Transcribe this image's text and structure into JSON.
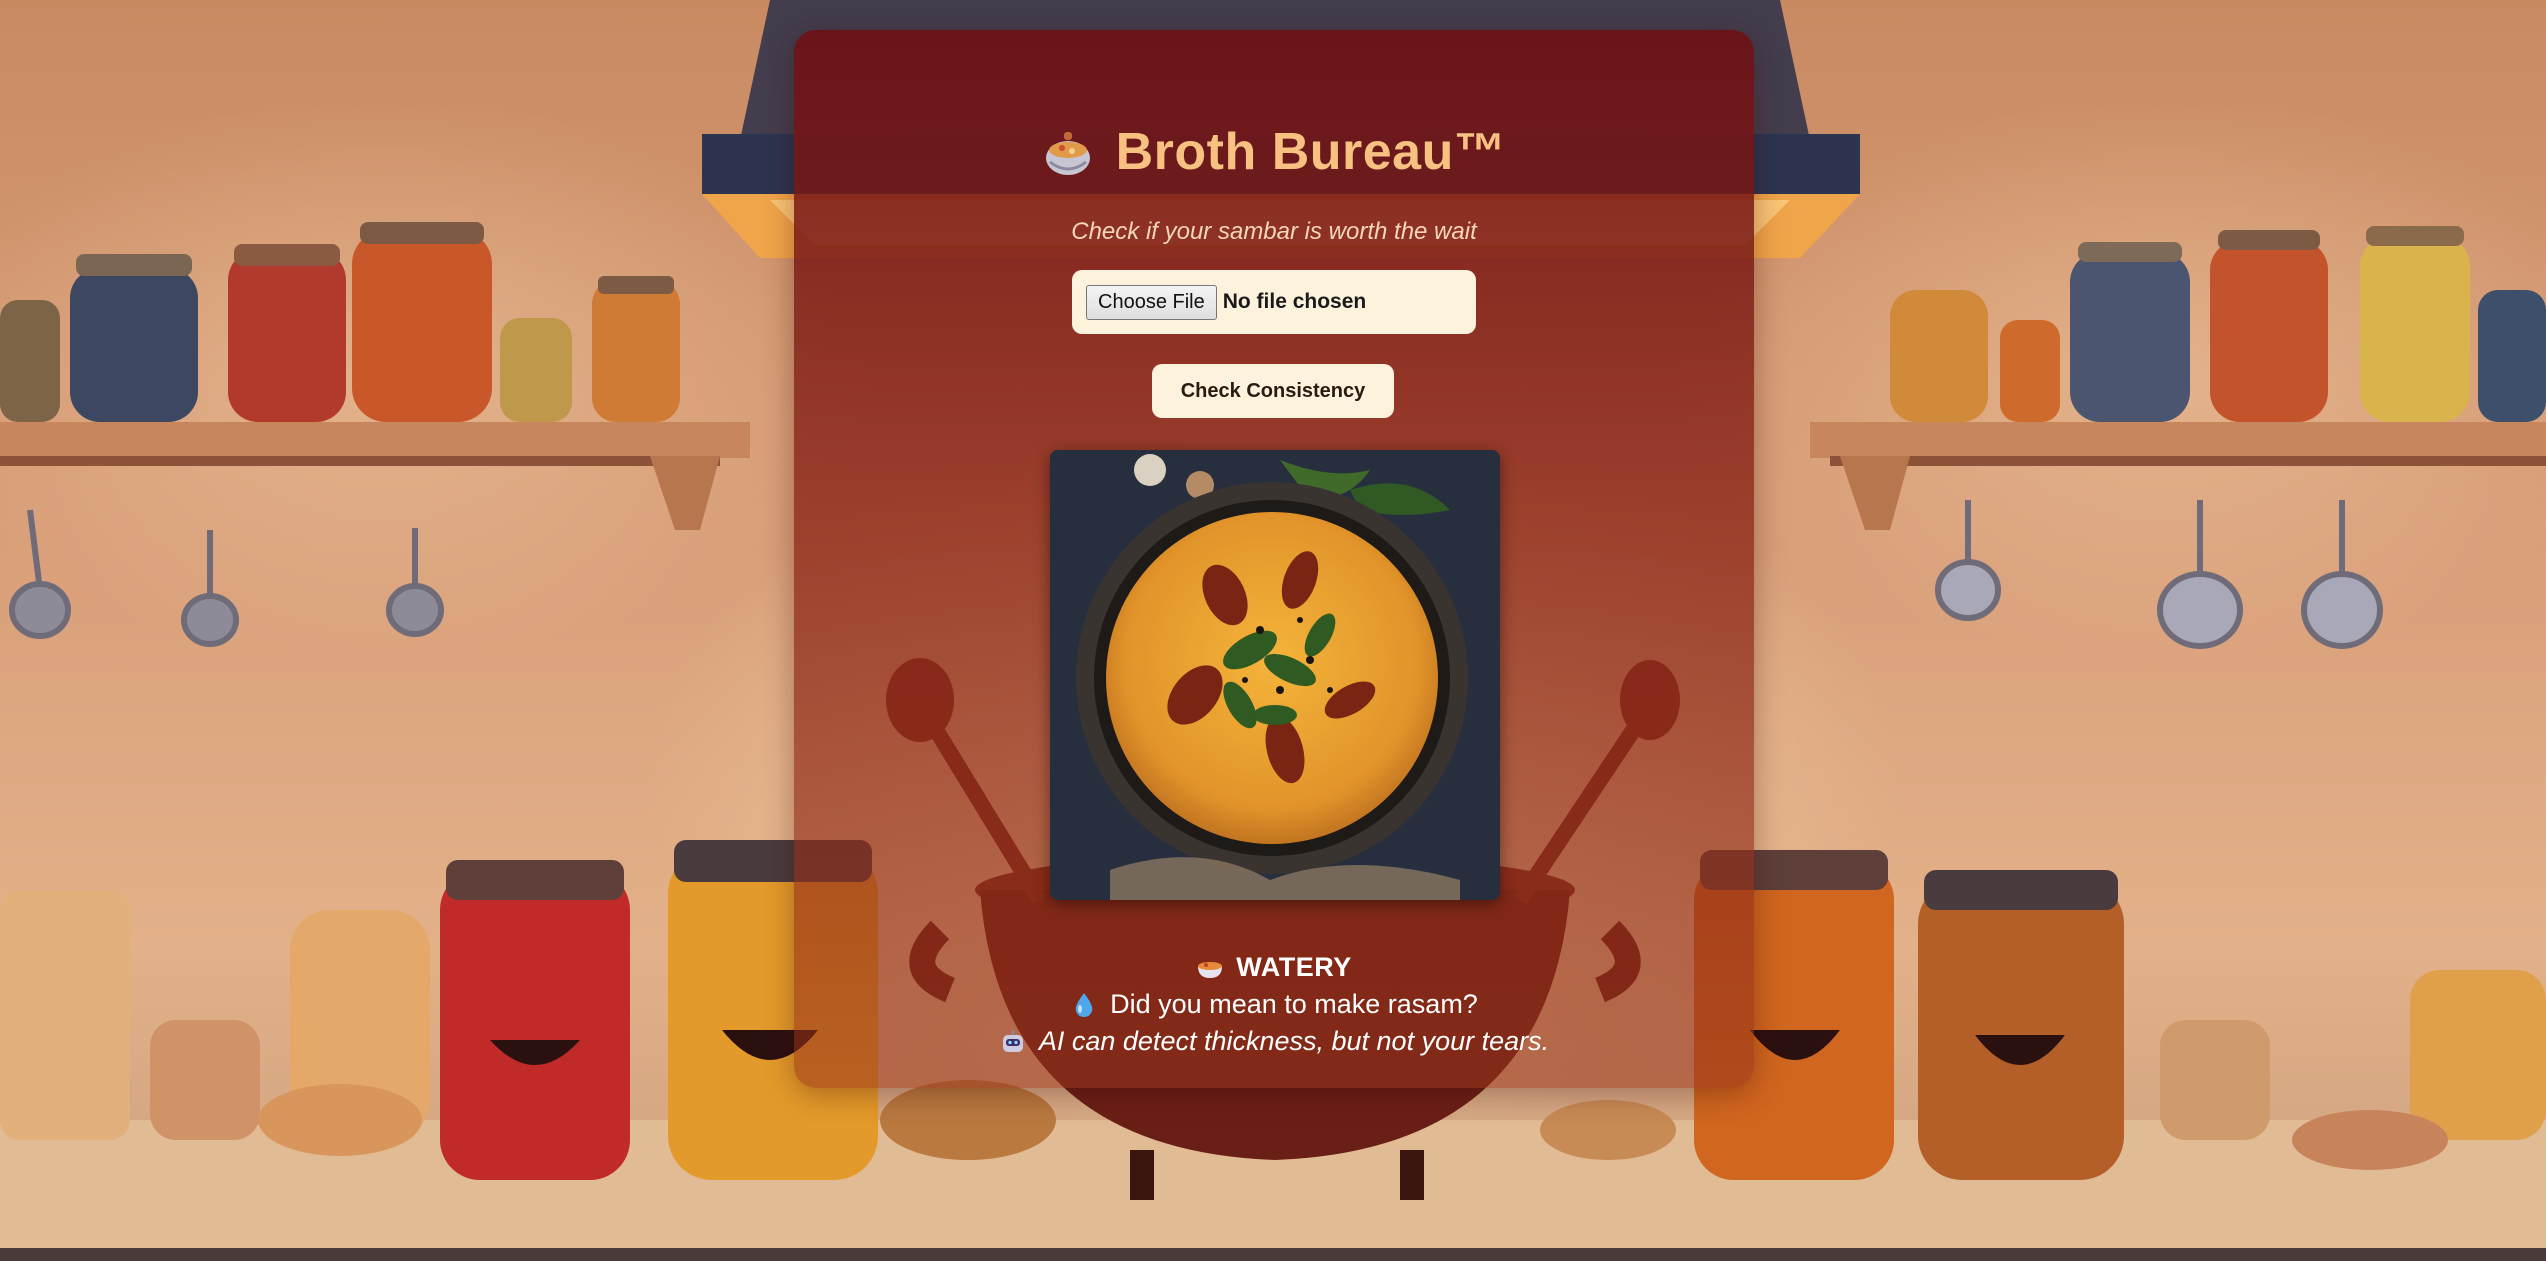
{
  "app": {
    "title": "Broth Bureau™",
    "subtitle": "Check if your sambar is worth the wait"
  },
  "upload": {
    "button_label": "Choose File",
    "status_text": "No file chosen"
  },
  "actions": {
    "check_label": "Check Consistency"
  },
  "result": {
    "verdict": "WATERY",
    "message": "Did you mean to make rasam?",
    "note": "AI can detect thickness, but not your tears."
  },
  "icons": {
    "title_icon": "pot-of-food-icon",
    "verdict_icon": "soup-bowl-icon",
    "message_icon": "droplet-icon",
    "note_icon": "robot-icon"
  },
  "colors": {
    "panel": "#6e1014",
    "title": "#f6c181",
    "button_bg": "#fdf3dd",
    "result_text": "#ffffff"
  }
}
